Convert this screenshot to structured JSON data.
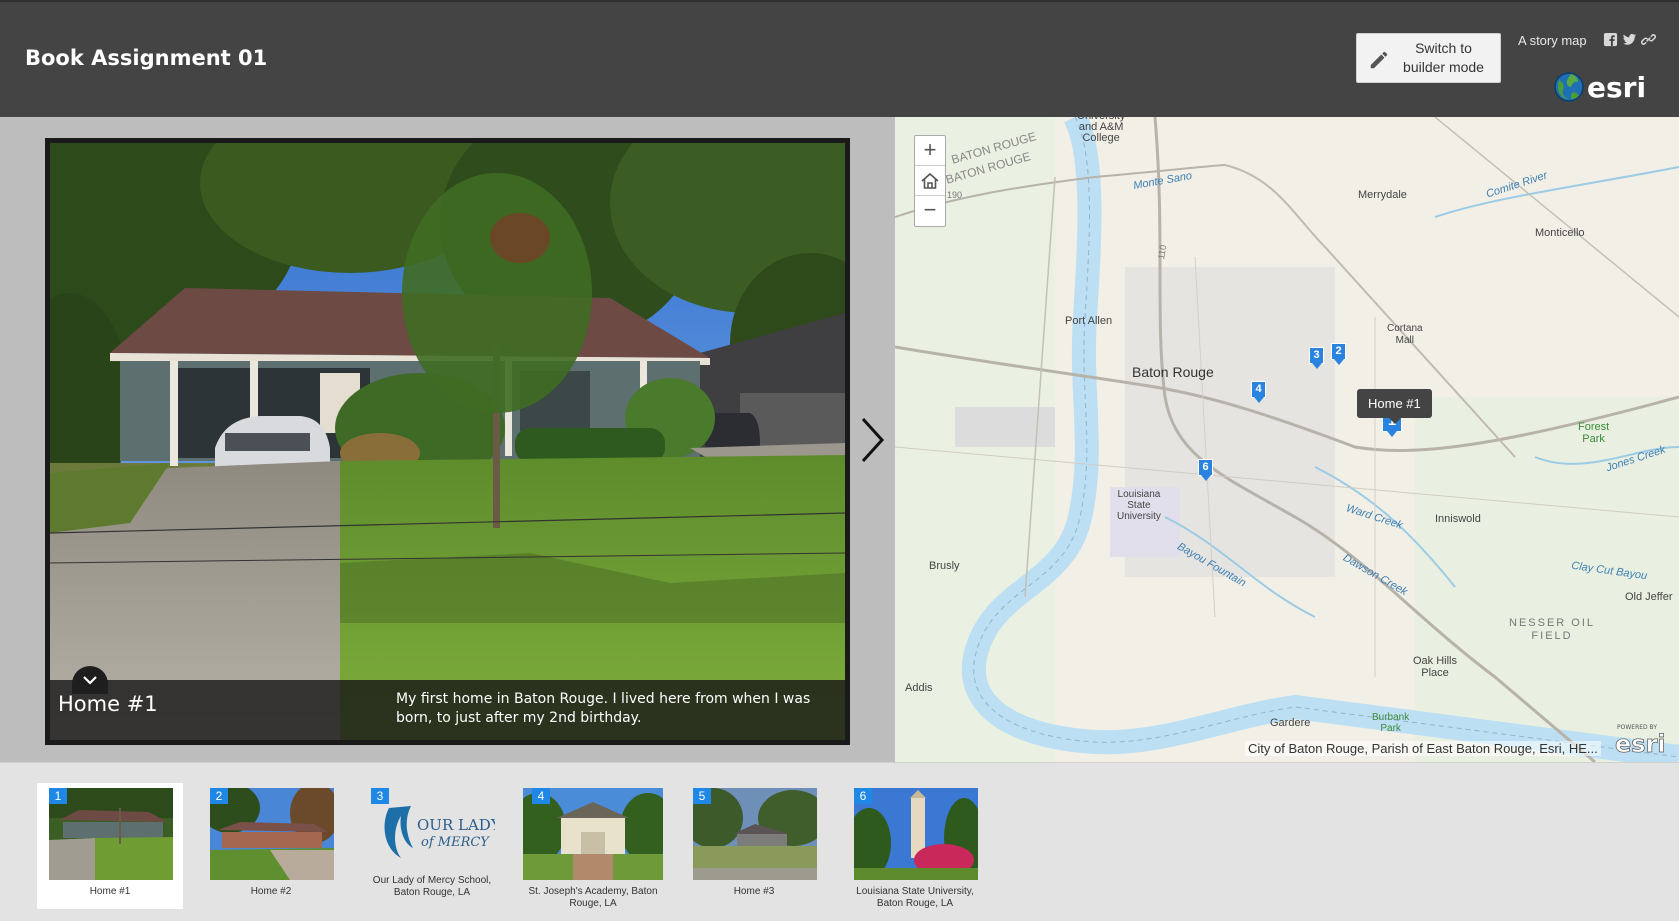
{
  "header": {
    "title": "Book Assignment 01",
    "builder_button": "Switch to\nbuilder mode",
    "storymap_label": "A story map",
    "logo_text": "esri"
  },
  "media": {
    "caption_title": "Home #1",
    "caption_description": "My first home in Baton Rouge. I lived here from when I was born, to just after my 2nd birthday."
  },
  "map": {
    "zoom_in": "+",
    "zoom_out": "−",
    "tooltip": "Home #1",
    "attribution": "City of Baton Rouge, Parish of East Baton Rouge, Esri, HE...",
    "powered_by": "POWERED BY",
    "labels": {
      "college": "University\nand A&M\nCollege",
      "baton_rouge_road1": "BATON ROUGE",
      "baton_rouge_road2": "W BATON ROUGE",
      "monte_sano": "Monte Sano",
      "merrydale": "Merrydale",
      "comite_river": "Comite River",
      "monticello": "Monticello",
      "port_allen": "Port Allen",
      "cortana_mall": "Cortana\nMall",
      "baton_rouge": "Baton Rouge",
      "forest_park": "Forest\nPark",
      "jones_creek": "Jones Creek",
      "lsu": "Louisiana\nState\nUniversity",
      "ward_creek": "Ward Creek",
      "inniswold": "Inniswold",
      "brusly": "Brusly",
      "bayou_fountain": "Bayou Fountain",
      "dawson_creek": "Dawson Creek",
      "clay_cut_bayou": "Clay Cut Bayou",
      "old_jefferson": "Old Jeffer",
      "nesser_oil": "NESSER OIL\nFIELD",
      "oak_hills": "Oak Hills\nPlace",
      "addis": "Addis",
      "gardere": "Gardere",
      "burbank_park": "Burbank\nPark",
      "highway_190": "190",
      "highway_110": "110"
    },
    "markers": [
      "1",
      "2",
      "3",
      "4",
      "6"
    ]
  },
  "thumbnails": [
    {
      "num": "1",
      "caption": "Home #1"
    },
    {
      "num": "2",
      "caption": "Home #2"
    },
    {
      "num": "3",
      "caption": "Our Lady of Mercy School, Baton Rouge, LA",
      "logo_line1": "OUR LADY",
      "logo_line2": "of MERCY"
    },
    {
      "num": "4",
      "caption": "St. Joseph's Academy, Baton Rouge, LA"
    },
    {
      "num": "5",
      "caption": "Home #3"
    },
    {
      "num": "6",
      "caption": "Louisiana State University, Baton Rouge, LA"
    }
  ],
  "colors": {
    "header_bg": "#444444",
    "accent_blue": "#2b83e0",
    "map_water": "#bcdff3",
    "media_bg": "#bdbdbd"
  },
  "icons": {
    "pencil": "pencil-icon",
    "facebook": "facebook-icon",
    "twitter": "twitter-icon",
    "link": "link-icon",
    "home": "home-icon",
    "next": "chevron-right-icon",
    "collapse": "chevron-down-icon"
  }
}
